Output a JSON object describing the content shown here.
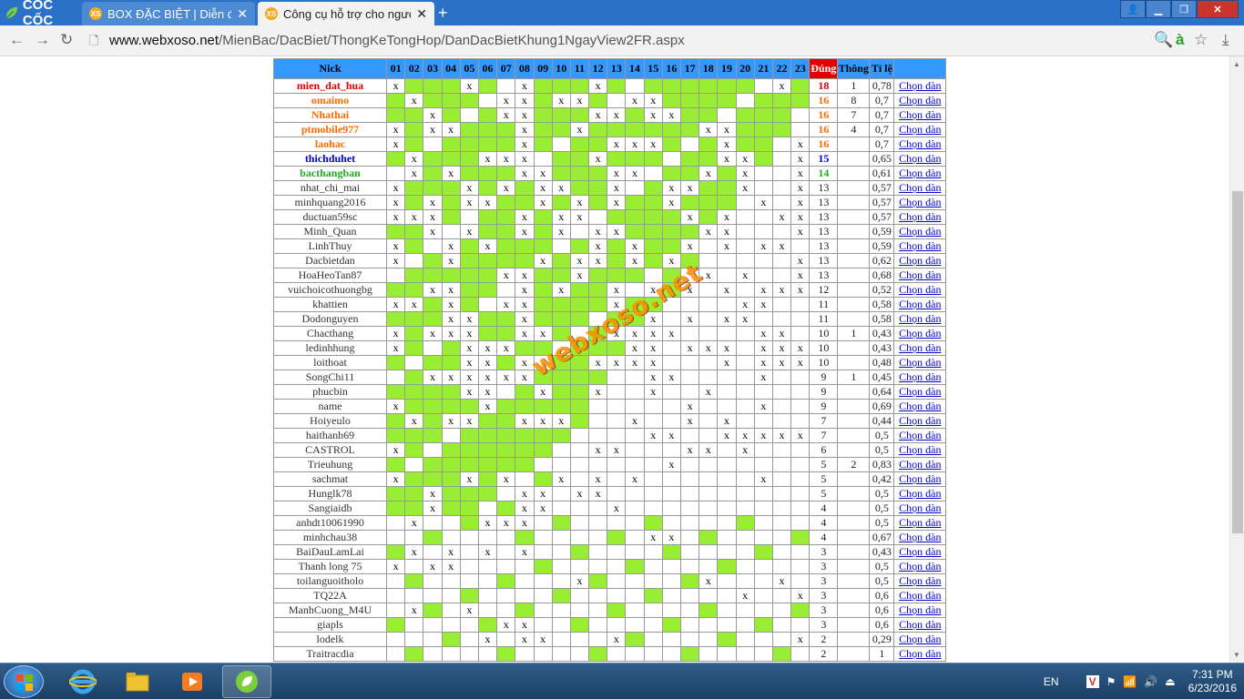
{
  "browser": {
    "brand": "CỐC CỐC",
    "tabs": [
      {
        "favicon": "XS",
        "title": "BOX ĐẶC BIỆT | Diễn đàn",
        "active": false
      },
      {
        "favicon": "XS",
        "title": "Công cụ hỗ trợ cho người",
        "active": true
      }
    ],
    "url_host": "www.webxoso.net",
    "url_path": "/MienBac/DacBiet/ThongKeTongHop/DanDacBietKhung1NgayView2FR.aspx"
  },
  "table": {
    "headers": {
      "nick": "Nick",
      "dung": "Đúng",
      "thong": "Thông",
      "tile": "Tỉ lệ",
      "action": ""
    },
    "numbers": [
      "01",
      "02",
      "03",
      "04",
      "05",
      "06",
      "07",
      "08",
      "09",
      "10",
      "11",
      "12",
      "13",
      "14",
      "15",
      "16",
      "17",
      "18",
      "19",
      "20",
      "21",
      "22",
      "23"
    ],
    "colors": {
      "header": "#3399ff",
      "green": "#99ee33",
      "dung_header": "#e00000",
      "link": "#0000cc"
    },
    "rows": [
      {
        "nick": "mien_dat_hua",
        "color": "#e00000",
        "bold": true,
        "x": [
          1,
          5,
          8,
          12,
          22
        ],
        "dung": "18",
        "thong": "1",
        "tile": "0,78",
        "link": "Chọn dàn"
      },
      {
        "nick": "omaimo",
        "color": "#ff6a00",
        "bold": true,
        "x": [
          2,
          7,
          8,
          10,
          11,
          14,
          15
        ],
        "dung": "16",
        "thong": "8",
        "tile": "0,7",
        "link": "Chọn dàn"
      },
      {
        "nick": "Nhathai",
        "color": "#ff6a00",
        "bold": true,
        "x": [
          3,
          7,
          8,
          12,
          13,
          15,
          16
        ],
        "dung": "16",
        "thong": "7",
        "tile": "0,7",
        "link": "Chọn dàn"
      },
      {
        "nick": "ptmobile977",
        "color": "#ff6a00",
        "bold": true,
        "x": [
          1,
          3,
          4,
          8,
          11,
          18,
          19
        ],
        "dung": "16",
        "thong": "4",
        "tile": "0,7",
        "link": "Chọn dàn"
      },
      {
        "nick": "laohac",
        "color": "#ff6a00",
        "bold": true,
        "x": [
          1,
          8,
          13,
          14,
          15,
          19,
          23
        ],
        "dung": "16",
        "thong": "",
        "tile": "0,7",
        "link": "Chọn dàn"
      },
      {
        "nick": "thichduhet",
        "color": "#0000dd",
        "bold": true,
        "x": [
          2,
          6,
          7,
          8,
          12,
          19,
          20,
          23
        ],
        "dung": "15",
        "thong": "",
        "tile": "0,65",
        "link": "Chọn dàn"
      },
      {
        "nick": "bacthangban",
        "color": "#22aa22",
        "bold": true,
        "x": [
          2,
          4,
          8,
          9,
          13,
          14,
          18,
          20,
          23
        ],
        "dung": "14",
        "thong": "",
        "tile": "0,61",
        "link": "Chọn dàn"
      },
      {
        "nick": "nhat_chi_mai",
        "color": "#333333",
        "bold": false,
        "x": [
          1,
          5,
          7,
          9,
          10,
          13,
          16,
          17,
          20,
          23
        ],
        "dung": "13",
        "thong": "",
        "tile": "0,57",
        "link": "Chọn dàn"
      },
      {
        "nick": "minhquang2016",
        "color": "#333333",
        "bold": false,
        "x": [
          1,
          3,
          5,
          6,
          9,
          11,
          13,
          16,
          21,
          23
        ],
        "dung": "13",
        "thong": "",
        "tile": "0,57",
        "link": "Chọn dàn"
      },
      {
        "nick": "ductuan59sc",
        "color": "#333333",
        "bold": false,
        "x": [
          1,
          2,
          3,
          8,
          10,
          11,
          17,
          19,
          22,
          23
        ],
        "dung": "13",
        "thong": "",
        "tile": "0,57",
        "link": "Chọn dàn"
      },
      {
        "nick": "Minh_Quan",
        "color": "#333333",
        "bold": false,
        "x": [
          3,
          5,
          8,
          10,
          12,
          13,
          18,
          19,
          23
        ],
        "dung": "13",
        "thong": "",
        "tile": "0,59",
        "link": "Chọn dàn"
      },
      {
        "nick": "LinhThuy",
        "color": "#333333",
        "bold": false,
        "x": [
          1,
          4,
          6,
          12,
          14,
          17,
          19,
          21,
          22
        ],
        "dung": "13",
        "thong": "",
        "tile": "0,59",
        "link": "Chọn dàn"
      },
      {
        "nick": "Dacbietdan",
        "color": "#333333",
        "bold": false,
        "x": [
          1,
          4,
          9,
          11,
          12,
          14,
          16,
          23
        ],
        "dung": "13",
        "thong": "",
        "tile": "0,62",
        "link": "Chọn dàn"
      },
      {
        "nick": "HoaHeoTan87",
        "color": "#333333",
        "bold": false,
        "x": [
          7,
          8,
          11,
          18,
          20,
          23
        ],
        "dung": "13",
        "thong": "",
        "tile": "0,68",
        "link": "Chọn dàn"
      },
      {
        "nick": "vuichoicothuongbg",
        "color": "#333333",
        "bold": false,
        "x": [
          3,
          4,
          8,
          10,
          13,
          15,
          17,
          19,
          21,
          22,
          23
        ],
        "dung": "12",
        "thong": "",
        "tile": "0,52",
        "link": "Chọn dàn"
      },
      {
        "nick": "khattien",
        "color": "#333333",
        "bold": false,
        "x": [
          1,
          2,
          4,
          7,
          8,
          13,
          20,
          21
        ],
        "dung": "11",
        "thong": "",
        "tile": "0,58",
        "link": "Chọn dàn"
      },
      {
        "nick": "Dodonguyen",
        "color": "#333333",
        "bold": false,
        "x": [
          4,
          5,
          8,
          15,
          17,
          19,
          20
        ],
        "dung": "11",
        "thong": "",
        "tile": "0,58",
        "link": "Chọn dàn"
      },
      {
        "nick": "Chacthang",
        "color": "#333333",
        "bold": false,
        "x": [
          1,
          3,
          4,
          5,
          8,
          9,
          13,
          14,
          15,
          16,
          21,
          22
        ],
        "dung": "10",
        "thong": "1",
        "tile": "0,43",
        "link": "Chọn dàn"
      },
      {
        "nick": "ledinhhung",
        "color": "#333333",
        "bold": false,
        "x": [
          1,
          5,
          6,
          7,
          14,
          15,
          17,
          18,
          19,
          21,
          22,
          23
        ],
        "dung": "10",
        "thong": "",
        "tile": "0,43",
        "link": "Chọn dàn"
      },
      {
        "nick": "loithoat",
        "color": "#333333",
        "bold": false,
        "x": [
          5,
          6,
          8,
          12,
          13,
          14,
          15,
          19,
          21,
          22,
          23
        ],
        "dung": "10",
        "thong": "",
        "tile": "0,48",
        "link": "Chọn dàn"
      },
      {
        "nick": "SongChi11",
        "color": "#333333",
        "bold": false,
        "x": [
          3,
          4,
          5,
          6,
          7,
          8,
          15,
          16,
          21
        ],
        "dung": "9",
        "thong": "1",
        "tile": "0,45",
        "link": "Chọn dàn"
      },
      {
        "nick": "phucbin",
        "color": "#333333",
        "bold": false,
        "x": [
          5,
          6,
          9,
          12,
          15,
          18
        ],
        "dung": "9",
        "thong": "",
        "tile": "0,64",
        "link": "Chọn dàn"
      },
      {
        "nick": "name",
        "color": "#333333",
        "bold": false,
        "x": [
          1,
          6,
          17,
          21
        ],
        "dung": "9",
        "thong": "",
        "tile": "0,69",
        "link": "Chọn dàn"
      },
      {
        "nick": "Hoiyeulo",
        "color": "#333333",
        "bold": false,
        "x": [
          2,
          4,
          5,
          8,
          9,
          10,
          14,
          17,
          19
        ],
        "dung": "7",
        "thong": "",
        "tile": "0,44",
        "link": "Chọn dàn"
      },
      {
        "nick": "haithanh69",
        "color": "#333333",
        "bold": false,
        "x": [
          15,
          16,
          19,
          20,
          21,
          22,
          23
        ],
        "dung": "7",
        "thong": "",
        "tile": "0,5",
        "link": "Chọn dàn"
      },
      {
        "nick": "CASTROL",
        "color": "#333333",
        "bold": false,
        "x": [
          1,
          12,
          13,
          17,
          18,
          20
        ],
        "dung": "6",
        "thong": "",
        "tile": "0,5",
        "link": "Chọn dàn"
      },
      {
        "nick": "Trieuhung",
        "color": "#333333",
        "bold": false,
        "x": [
          16
        ],
        "dung": "5",
        "thong": "2",
        "tile": "0,83",
        "link": "Chọn dàn"
      },
      {
        "nick": "sachmat",
        "color": "#333333",
        "bold": false,
        "x": [
          1,
          5,
          7,
          10,
          12,
          14,
          21
        ],
        "dung": "5",
        "thong": "",
        "tile": "0,42",
        "link": "Chọn dàn"
      },
      {
        "nick": "Hunglk78",
        "color": "#333333",
        "bold": false,
        "x": [
          3,
          8,
          9,
          11,
          12
        ],
        "dung": "5",
        "thong": "",
        "tile": "0,5",
        "link": "Chọn dàn"
      },
      {
        "nick": "Sangiaidb",
        "color": "#333333",
        "bold": false,
        "x": [
          3,
          8,
          9,
          13
        ],
        "dung": "4",
        "thong": "",
        "tile": "0,5",
        "link": "Chọn dàn"
      },
      {
        "nick": "anhdt10061990",
        "color": "#333333",
        "bold": false,
        "x": [
          2,
          6,
          7,
          8
        ],
        "dung": "4",
        "thong": "",
        "tile": "0,5",
        "link": "Chọn dàn"
      },
      {
        "nick": "minhchau38",
        "color": "#333333",
        "bold": false,
        "x": [
          15,
          16
        ],
        "dung": "4",
        "thong": "",
        "tile": "0,67",
        "link": "Chọn dàn"
      },
      {
        "nick": "BaiDauLamLai",
        "color": "#333333",
        "bold": false,
        "x": [
          2,
          4,
          6,
          8
        ],
        "dung": "3",
        "thong": "",
        "tile": "0,43",
        "link": "Chọn dàn"
      },
      {
        "nick": "Thanh long 75",
        "color": "#333333",
        "bold": false,
        "x": [
          1,
          3,
          4
        ],
        "dung": "3",
        "thong": "",
        "tile": "0,5",
        "link": "Chọn dàn"
      },
      {
        "nick": "toilanguoitholo",
        "color": "#333333",
        "bold": false,
        "x": [
          11,
          18,
          22
        ],
        "dung": "3",
        "thong": "",
        "tile": "0,5",
        "link": "Chọn dàn"
      },
      {
        "nick": "TQ22A",
        "color": "#333333",
        "bold": false,
        "x": [
          20,
          23
        ],
        "dung": "3",
        "thong": "",
        "tile": "0,6",
        "link": "Chọn dàn"
      },
      {
        "nick": "ManhCuong_M4U",
        "color": "#333333",
        "bold": false,
        "x": [
          2,
          5
        ],
        "dung": "3",
        "thong": "",
        "tile": "0,6",
        "link": "Chọn dàn"
      },
      {
        "nick": "giapls",
        "color": "#333333",
        "bold": false,
        "x": [
          7,
          8
        ],
        "dung": "3",
        "thong": "",
        "tile": "0,6",
        "link": "Chọn dàn"
      },
      {
        "nick": "lodelk",
        "color": "#333333",
        "bold": false,
        "x": [
          6,
          8,
          9,
          13,
          23
        ],
        "dung": "2",
        "thong": "",
        "tile": "0,29",
        "link": "Chọn dàn"
      },
      {
        "nick": "Traitracdia",
        "color": "#333333",
        "bold": false,
        "x": [],
        "dung": "2",
        "thong": "",
        "tile": "1",
        "link": "Chọn dàn"
      }
    ]
  },
  "watermark": "webxoso.net",
  "taskbar": {
    "lang": "EN",
    "time": "7:31 PM",
    "date": "6/23/2016"
  }
}
